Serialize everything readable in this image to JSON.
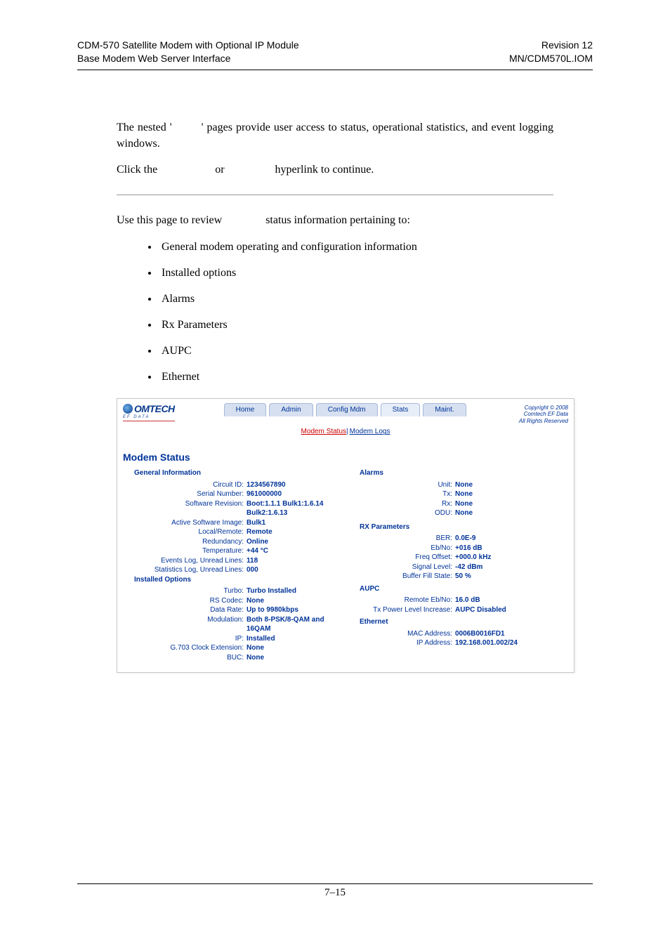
{
  "header": {
    "left_line1": "CDM-570 Satellite Modem with Optional IP Module",
    "left_line2": "Base Modem Web Server Interface",
    "right_line1": "Revision 12",
    "right_line2": "MN/CDM570L.IOM"
  },
  "body": {
    "p1a": "The nested '",
    "p1b": "' pages provide user access to status, operational statistics, and event logging windows.",
    "p2a": "Click the",
    "p2_or": "or",
    "p2b": "hyperlink to continue.",
    "p3a": "Use this page to review",
    "p3b": "status information pertaining to:",
    "bullets": [
      "General modem operating and configuration information",
      "Installed options",
      "Alarms",
      "Rx Parameters",
      "AUPC",
      "Ethernet"
    ]
  },
  "shot": {
    "logo_text": "OMTECH",
    "logo_sub": "EF DATA",
    "nav": {
      "home": "Home",
      "admin": "Admin",
      "config": "Config Mdm",
      "stats": "Stats",
      "maint": "Maint."
    },
    "subnav": {
      "status": "Modem Status",
      "logs": "Modem Logs"
    },
    "copyright": {
      "l1": "Copyright © 2008",
      "l2": "Comtech EF Data",
      "l3": "All Rights Reserved"
    },
    "title": "Modem Status",
    "left": {
      "general_hdr": "General Information",
      "circuit_id_l": "Circuit ID:",
      "circuit_id_v": "1234567890",
      "serial_l": "Serial Number:",
      "serial_v": "961000000",
      "sw_l": "Software Revision:",
      "sw_v": "Boot:1.1.1 Bulk1:1.6.14 Bulk2:1.6.13",
      "active_l": "Active Software Image:",
      "active_v": "Bulk1",
      "lr_l": "Local/Remote:",
      "lr_v": "Remote",
      "red_l": "Redundancy:",
      "red_v": "Online",
      "temp_l": "Temperature:",
      "temp_v": "+44 °C",
      "ev_l": "Events Log, Unread Lines:",
      "ev_v": "118",
      "st_l": "Statistics Log, Unread Lines:",
      "st_v": "000",
      "installed_hdr": "Installed Options",
      "turbo_l": "Turbo:",
      "turbo_v": "Turbo Installed",
      "rs_l": "RS Codec:",
      "rs_v": "None",
      "dr_l": "Data Rate:",
      "dr_v": "Up to 9980kbps",
      "mod_l": "Modulation:",
      "mod_v": "Both 8-PSK/8-QAM and 16QAM",
      "ip_l": "IP:",
      "ip_v": "Installed",
      "g703_l": "G.703 Clock Extension:",
      "g703_v": "None",
      "buc_l": "BUC:",
      "buc_v": "None"
    },
    "right": {
      "alarms_hdr": "Alarms",
      "unit_l": "Unit:",
      "unit_v": "None",
      "tx_l": "Tx:",
      "tx_v": "None",
      "rx_l": "Rx:",
      "rx_v": "None",
      "odu_l": "ODU:",
      "odu_v": "None",
      "rxp_hdr": "RX Parameters",
      "ber_l": "BER:",
      "ber_v": "0.0E-9",
      "ebno_l": "Eb/No:",
      "ebno_v": "+016 dB",
      "freq_l": "Freq Offset:",
      "freq_v": "+000.0 kHz",
      "sig_l": "Signal Level:",
      "sig_v": "-42 dBm",
      "buf_l": "Buffer Fill State:",
      "buf_v": "50 %",
      "aupc_hdr": "AUPC",
      "rebno_l": "Remote Eb/No:",
      "rebno_v": "16.0 dB",
      "txp_l": "Tx Power Level Increase:",
      "txp_v": "AUPC Disabled",
      "eth_hdr": "Ethernet",
      "mac_l": "MAC Address:",
      "mac_v": "0006B0016FD1",
      "ipa_l": "IP Address:",
      "ipa_v": "192.168.001.002/24"
    }
  },
  "pagenum": "7–15"
}
